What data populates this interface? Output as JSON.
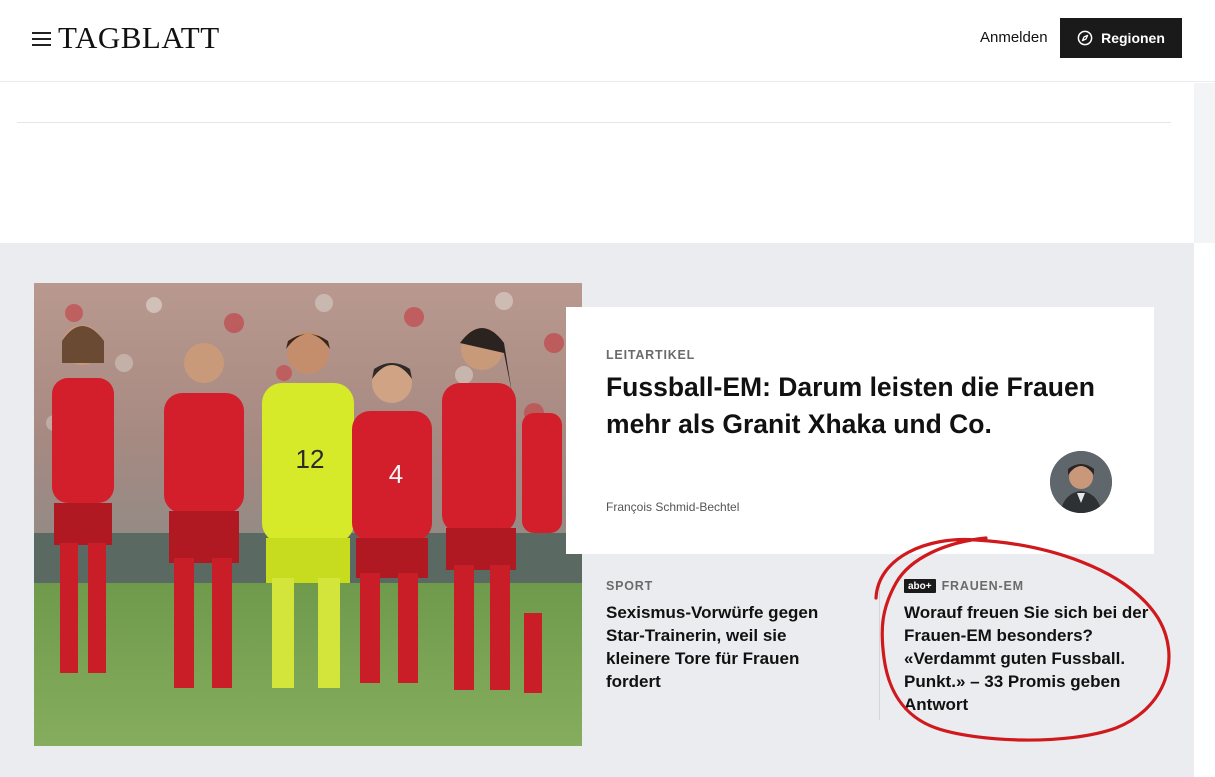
{
  "header": {
    "logo": "TAGBLATT",
    "login_label": "Anmelden",
    "regions_label": "Regionen"
  },
  "lead": {
    "kicker": "LEITARTIKEL",
    "title": "Fussball-EM: Darum leisten die Frauen mehr als Granit Xhaka und Co.",
    "author": "François Schmid-Bechtel"
  },
  "teasers": [
    {
      "kicker": "SPORT",
      "title": "Sexismus-Vorwürfe gegen Star-Trainerin, weil sie kleinere Tore für Frauen fordert"
    },
    {
      "badge": "abo+",
      "kicker": "FRAUEN-EM",
      "title": "Worauf freuen Sie sich bei der Frauen-EM besonders? «Verdammt guten Fussball. Punkt.» – 33 Promis geben Antwort"
    }
  ],
  "colors": {
    "section_bg": "#ebecef",
    "button_bg": "#1a1a1a",
    "jersey_red": "#d21f2b",
    "keeper_yellow": "#d6ea2a",
    "annotation_red": "#d0191c"
  },
  "icons": {
    "menu": "hamburger-icon",
    "regions": "compass-icon"
  }
}
